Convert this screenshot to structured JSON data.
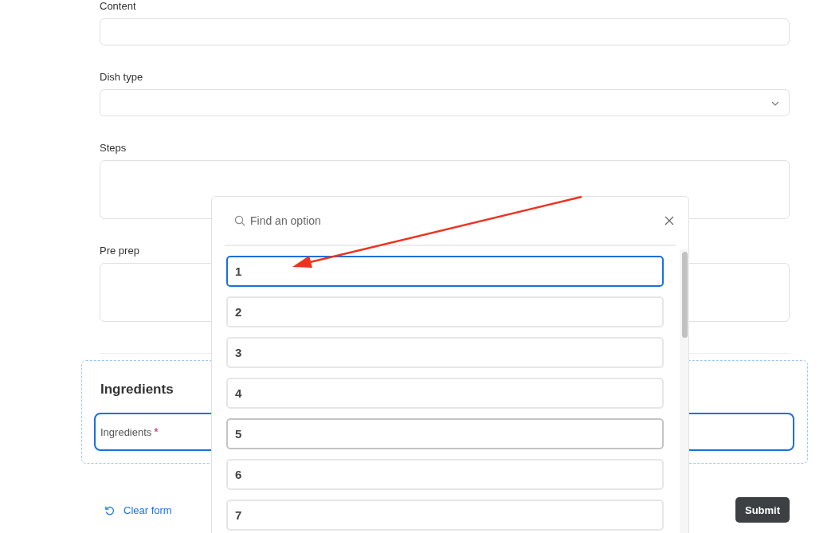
{
  "form": {
    "fields": [
      {
        "kind": "input",
        "label": "Content"
      },
      {
        "kind": "select",
        "label": "Dish type"
      },
      {
        "kind": "textarea",
        "label": "Steps"
      },
      {
        "kind": "textarea",
        "label": "Pre prep"
      }
    ]
  },
  "ingredients": {
    "heading": "Ingredients",
    "field_label": "Ingredients",
    "required_mark": "*"
  },
  "actions": {
    "clear": "Clear form",
    "submit": "Submit"
  },
  "picker": {
    "placeholder": "Find an option",
    "options": [
      {
        "label": "1",
        "selected": true,
        "hovered": false
      },
      {
        "label": "2",
        "selected": false,
        "hovered": false
      },
      {
        "label": "3",
        "selected": false,
        "hovered": false
      },
      {
        "label": "4",
        "selected": false,
        "hovered": false
      },
      {
        "label": "5",
        "selected": false,
        "hovered": true
      },
      {
        "label": "6",
        "selected": false,
        "hovered": false
      },
      {
        "label": "7",
        "selected": false,
        "hovered": false
      }
    ]
  }
}
